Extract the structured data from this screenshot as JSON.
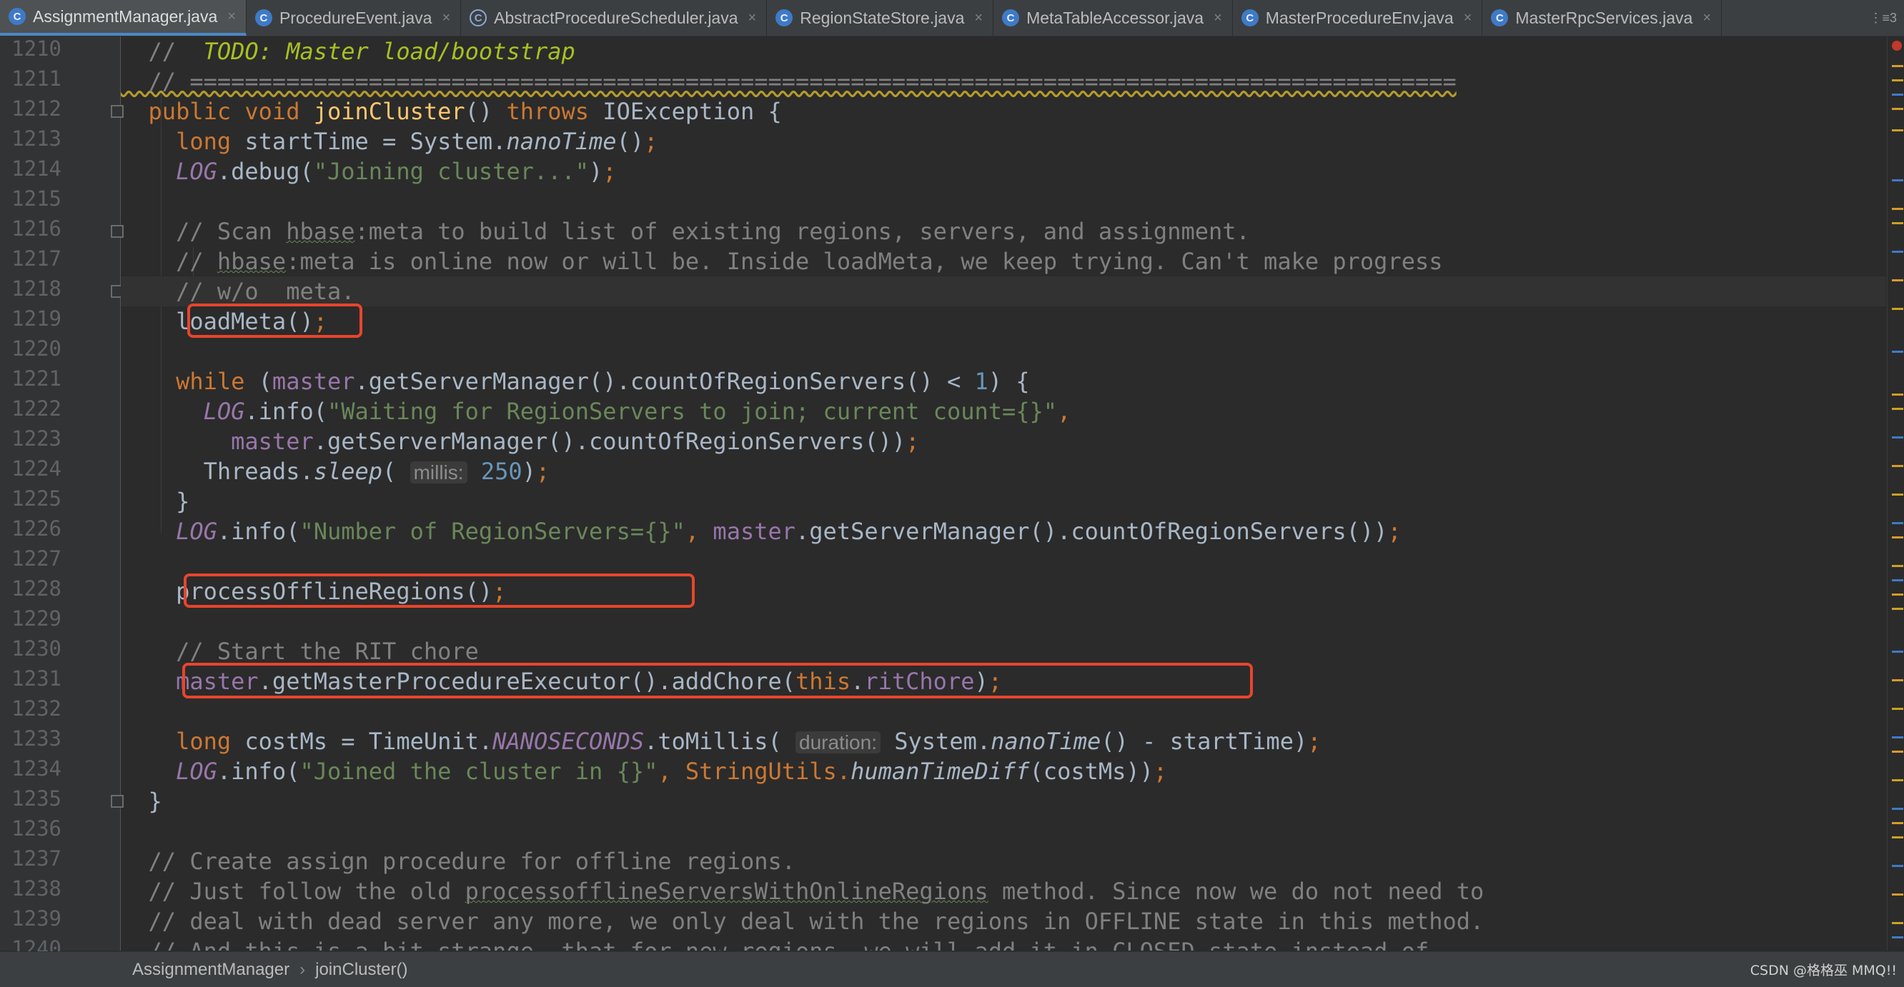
{
  "tabs": [
    {
      "label": "AssignmentManager.java",
      "active": true,
      "icon": "class-icon"
    },
    {
      "label": "ProcedureEvent.java",
      "active": false,
      "icon": "class-icon"
    },
    {
      "label": "AbstractProcedureScheduler.java",
      "active": false,
      "icon": "abstract-class-icon"
    },
    {
      "label": "RegionStateStore.java",
      "active": false,
      "icon": "class-icon"
    },
    {
      "label": "MetaTableAccessor.java",
      "active": false,
      "icon": "class-icon"
    },
    {
      "label": "MasterProcedureEnv.java",
      "active": false,
      "icon": "class-icon"
    },
    {
      "label": "MasterRpcServices.java",
      "active": false,
      "icon": "class-icon"
    }
  ],
  "tab_overflow": "⋮≡3",
  "editor": {
    "line_numbers": [
      "1210",
      "1211",
      "1212",
      "1213",
      "1214",
      "1215",
      "1216",
      "1217",
      "1218",
      "1219",
      "1220",
      "1221",
      "1222",
      "1223",
      "1224",
      "1225",
      "1226",
      "1227",
      "1228",
      "1229",
      "1230",
      "1231",
      "1232",
      "1233",
      "1234",
      "1235",
      "1236",
      "1237",
      "1238",
      "1239",
      "1240"
    ],
    "current_line": "1218",
    "highlighted_calls": [
      "loadMeta();",
      "processOfflineRegions();",
      "master.getMasterProcedureExecutor().addChore(this.ritChore);"
    ],
    "code": {
      "l1210_a": "  //  ",
      "l1210_b": "TODO: Master load/bootstrap",
      "l1211": "  // ============================================================================================",
      "l1212_kw": "  public void ",
      "l1212_fn": "joinCluster",
      "l1212_b": "() ",
      "l1212_kw2": "throws",
      "l1212_c": " IOException {",
      "l1213_kw": "    long",
      "l1213_b": " startTime = System.",
      "l1213_it": "nanoTime",
      "l1213_c": "()",
      "l1213_semi": ";",
      "l1214_it": "    LOG",
      "l1214_b": ".debug(",
      "l1214_st": "\"Joining cluster...\"",
      "l1214_c": ")",
      "l1214_semi": ";",
      "l1216_a": "    // Scan ",
      "l1216_sq": "hbase",
      "l1216_b": ":meta to build list of existing regions, servers, and assignment.",
      "l1217_a": "    // ",
      "l1217_sq": "hbase",
      "l1217_b": ":meta is online now or will be. Inside loadMeta, we keep trying. Can't make progress",
      "l1218": "    // w/o  meta.",
      "l1219_a": "    loadMeta()",
      "l1219_semi": ";",
      "l1221_kw": "    while",
      "l1221_a": " (",
      "l1221_fld": "master",
      "l1221_b": ".getServerManager().countOfRegionServers() < ",
      "l1221_nm": "1",
      "l1221_c": ") {",
      "l1222_it": "      LOG",
      "l1222_b": ".info(",
      "l1222_st": "\"Waiting for RegionServers to join; current count={}\"",
      "l1222_c": ",",
      "l1223_a": "        ",
      "l1223_fld": "master",
      "l1223_b": ".getServerManager().countOfRegionServers())",
      "l1223_semi": ";",
      "l1224_a": "      Threads.",
      "l1224_it": "sleep",
      "l1224_b": "( ",
      "l1224_hint": "millis:",
      "l1224_nm": " 250",
      "l1224_c": ")",
      "l1224_semi": ";",
      "l1225": "    }",
      "l1226_it": "    LOG",
      "l1226_b": ".info(",
      "l1226_st": "\"Number of RegionServers={}\"",
      "l1226_c": ", ",
      "l1226_fld": "master",
      "l1226_d": ".getServerManager().countOfRegionServers())",
      "l1226_semi": ";",
      "l1228_a": "    processOfflineRegions()",
      "l1228_semi": ";",
      "l1230": "    // Start the RIT chore",
      "l1231_a": "    ",
      "l1231_fld": "master",
      "l1231_b": ".getMasterProcedureExecutor().addChore(",
      "l1231_kw": "this",
      "l1231_c": ".",
      "l1231_fld2": "ritChore",
      "l1231_d": ")",
      "l1231_semi": ";",
      "l1233_kw": "    long",
      "l1233_a": " costMs = TimeUnit.",
      "l1233_sfld": "NANOSECONDS",
      "l1233_b": ".toMillis( ",
      "l1233_hint": "duration:",
      "l1233_c": " System.",
      "l1233_it": "nanoTime",
      "l1233_d": "() - startTime)",
      "l1233_semi": ";",
      "l1234_it": "    LOG",
      "l1234_a": ".info(",
      "l1234_st": "\"Joined the cluster in {}\"",
      "l1234_b": ", StringUtils.",
      "l1234_it2": "humanTimeDiff",
      "l1234_c": "(costMs))",
      "l1234_semi": ";",
      "l1235": "  }",
      "l1237": "  // Create assign procedure for offline regions.",
      "l1238_a": "  // Just follow the old ",
      "l1238_sq": "processofflineServersWithOnlineRegions",
      "l1238_b": " method. Since now we do not need to",
      "l1239": "  // deal with dead server any more, we only deal with the regions in OFFLINE state in this method.",
      "l1240": "  // And this is a bit strange, that for new regions, we will add it in CLOSED state instead of"
    }
  },
  "breadcrumb": {
    "class": "AssignmentManager",
    "separator": "›",
    "method": "joinCluster()"
  },
  "watermark": "CSDN @格格巫 MMQ!!",
  "colors": {
    "keyword": "#cc7832",
    "string": "#6a8759",
    "comment": "#808080",
    "field": "#9876aa",
    "number": "#6897bb",
    "method": "#ffc66d",
    "highlight_box": "#e8452c",
    "tab_active_underline": "#4a88c7"
  }
}
